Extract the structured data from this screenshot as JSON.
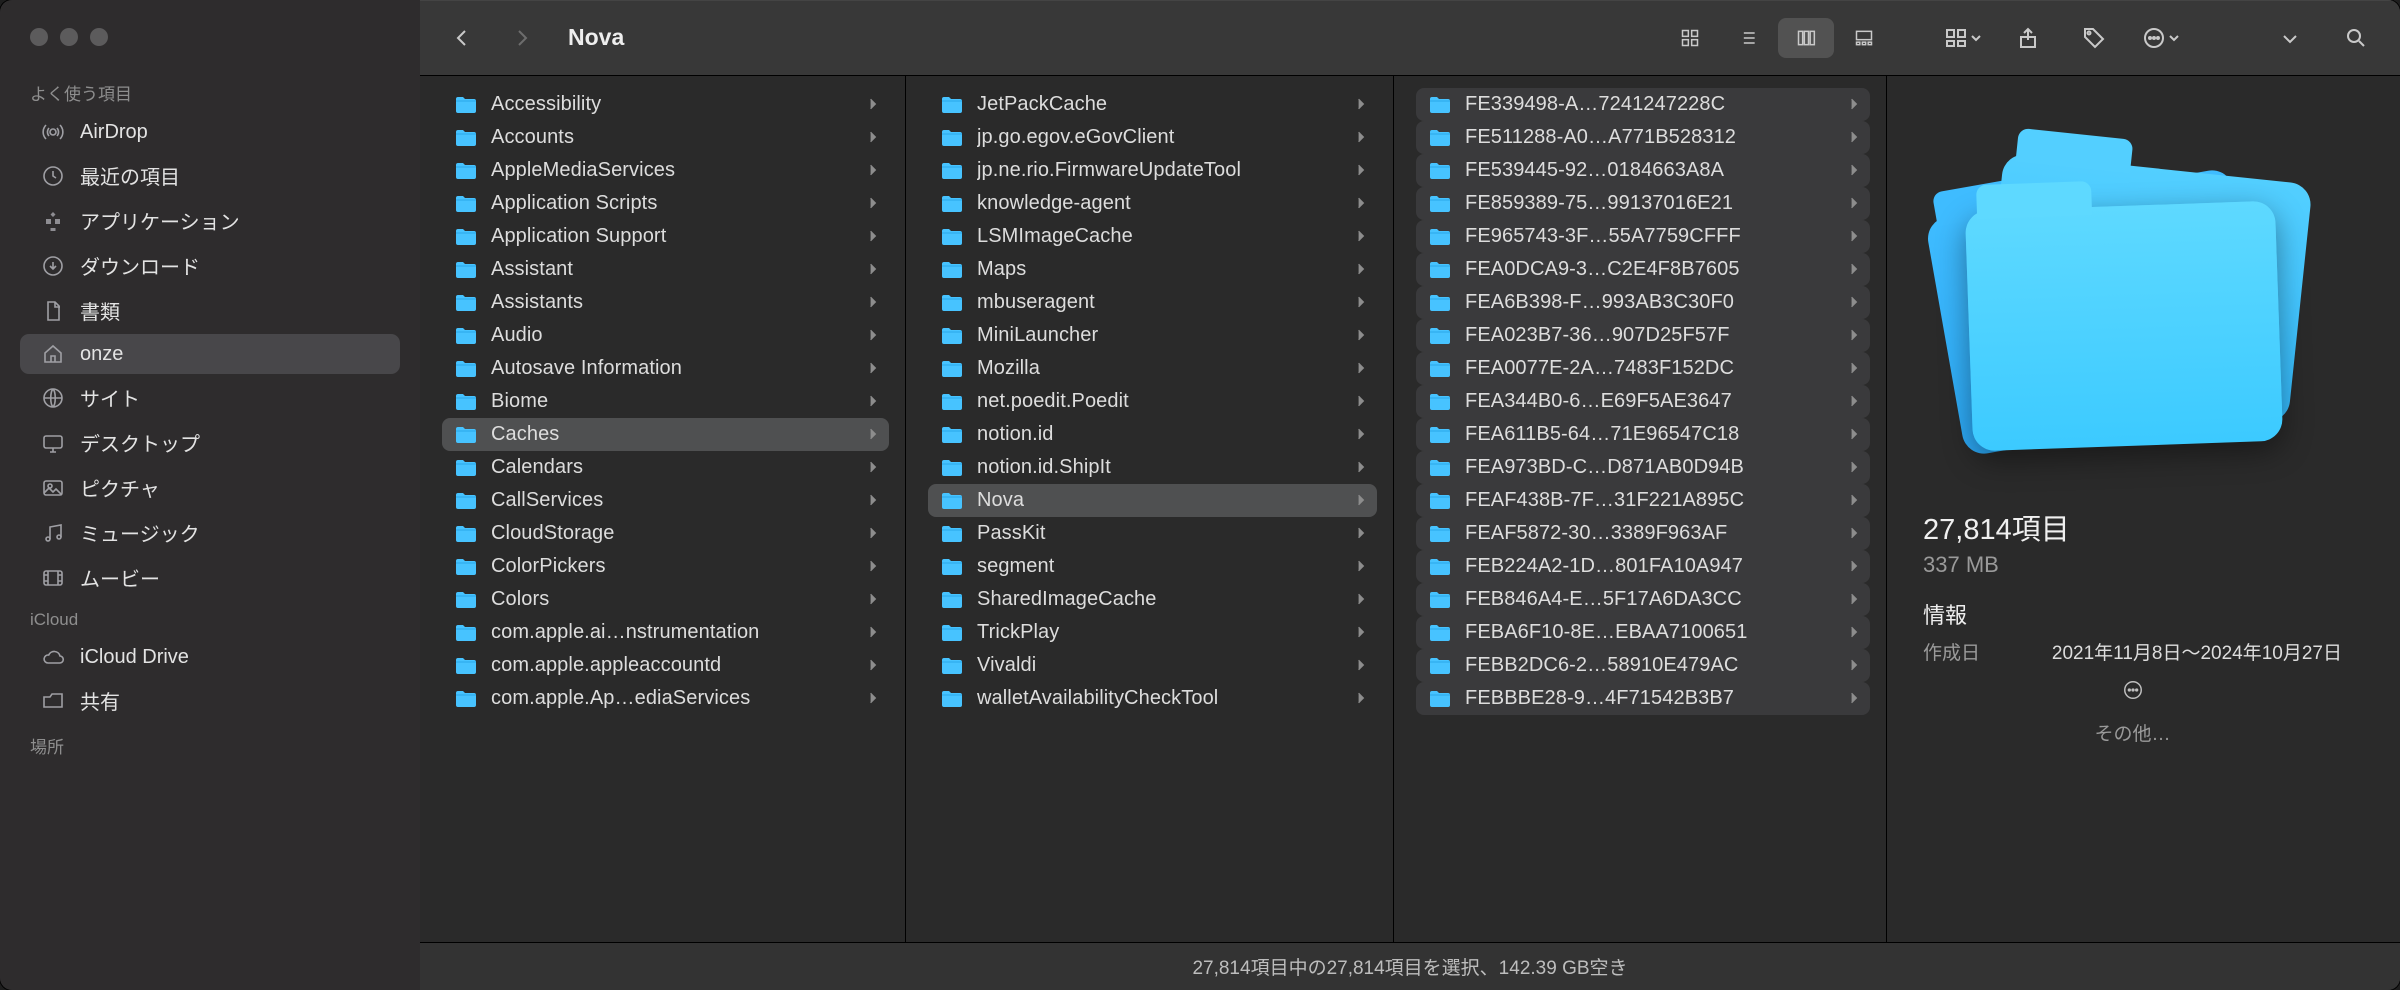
{
  "window": {
    "title": "Nova"
  },
  "sidebar": {
    "sections": [
      {
        "header": "よく使う項目",
        "items": [
          {
            "icon": "airdrop-icon",
            "label": "AirDrop"
          },
          {
            "icon": "clock-icon",
            "label": "最近の項目"
          },
          {
            "icon": "apps-icon",
            "label": "アプリケーション"
          },
          {
            "icon": "download-icon",
            "label": "ダウンロード"
          },
          {
            "icon": "doc-icon",
            "label": "書類"
          },
          {
            "icon": "home-icon",
            "label": "onze",
            "selected": true
          },
          {
            "icon": "site-icon",
            "label": "サイト"
          },
          {
            "icon": "desktop-icon",
            "label": "デスクトップ"
          },
          {
            "icon": "picture-icon",
            "label": "ピクチャ"
          },
          {
            "icon": "music-icon",
            "label": "ミュージック"
          },
          {
            "icon": "movie-icon",
            "label": "ムービー"
          }
        ]
      },
      {
        "header": "iCloud",
        "items": [
          {
            "icon": "cloud-icon",
            "label": "iCloud Drive"
          },
          {
            "icon": "shared-icon",
            "label": "共有"
          }
        ]
      },
      {
        "header": "場所",
        "items": []
      }
    ]
  },
  "columns": {
    "col1": [
      {
        "label": "Accessibility"
      },
      {
        "label": "Accounts"
      },
      {
        "label": "AppleMediaServices"
      },
      {
        "label": "Application Scripts"
      },
      {
        "label": "Application Support"
      },
      {
        "label": "Assistant"
      },
      {
        "label": "Assistants"
      },
      {
        "label": "Audio"
      },
      {
        "label": "Autosave Information"
      },
      {
        "label": "Biome"
      },
      {
        "label": "Caches",
        "selected": true
      },
      {
        "label": "Calendars"
      },
      {
        "label": "CallServices"
      },
      {
        "label": "CloudStorage"
      },
      {
        "label": "ColorPickers"
      },
      {
        "label": "Colors"
      },
      {
        "label": "com.apple.ai…nstrumentation"
      },
      {
        "label": "com.apple.appleaccountd"
      },
      {
        "label": "com.apple.Ap…ediaServices"
      }
    ],
    "col2": [
      {
        "label": "JetPackCache"
      },
      {
        "label": "jp.go.egov.eGovClient"
      },
      {
        "label": "jp.ne.rio.FirmwareUpdateTool"
      },
      {
        "label": "knowledge-agent"
      },
      {
        "label": "LSMImageCache"
      },
      {
        "label": "Maps"
      },
      {
        "label": "mbuseragent"
      },
      {
        "label": "MiniLauncher"
      },
      {
        "label": "Mozilla"
      },
      {
        "label": "net.poedit.Poedit"
      },
      {
        "label": "notion.id"
      },
      {
        "label": "notion.id.ShipIt"
      },
      {
        "label": "Nova",
        "selected": true
      },
      {
        "label": "PassKit"
      },
      {
        "label": "segment"
      },
      {
        "label": "SharedImageCache"
      },
      {
        "label": "TrickPlay"
      },
      {
        "label": "Vivaldi"
      },
      {
        "label": "walletAvailabilityCheckTool"
      }
    ],
    "col3": [
      {
        "label": "FE339498-A…7241247228C"
      },
      {
        "label": "FE511288-A0…A771B528312"
      },
      {
        "label": "FE539445-92…0184663A8A"
      },
      {
        "label": "FE859389-75…99137016E21"
      },
      {
        "label": "FE965743-3F…55A7759CFFF"
      },
      {
        "label": "FEA0DCA9-3…C2E4F8B7605"
      },
      {
        "label": "FEA6B398-F…993AB3C30F0"
      },
      {
        "label": "FEA023B7-36…907D25F57F"
      },
      {
        "label": "FEA0077E-2A…7483F152DC"
      },
      {
        "label": "FEA344B0-6…E69F5AE3647"
      },
      {
        "label": "FEA611B5-64…71E96547C18"
      },
      {
        "label": "FEA973BD-C…D871AB0D94B"
      },
      {
        "label": "FEAF438B-7F…31F221A895C"
      },
      {
        "label": "FEAF5872-30…3389F963AF"
      },
      {
        "label": "FEB224A2-1D…801FA10A947"
      },
      {
        "label": "FEB846A4-E…5F17A6DA3CC"
      },
      {
        "label": "FEBA6F10-8E…EBAA7100651"
      },
      {
        "label": "FEBB2DC6-2…58910E479AC"
      },
      {
        "label": "FEBBBE28-9…4F71542B3B7"
      }
    ]
  },
  "preview": {
    "count_label": "27,814項目",
    "size_label": "337 MB",
    "info_header": "情報",
    "created_key": "作成日",
    "created_value": "2021年11月8日〜2024年10月27日",
    "other_label": "その他…"
  },
  "statusbar": {
    "text": "27,814項目中の27,814項目を選択、142.39 GB空き"
  }
}
